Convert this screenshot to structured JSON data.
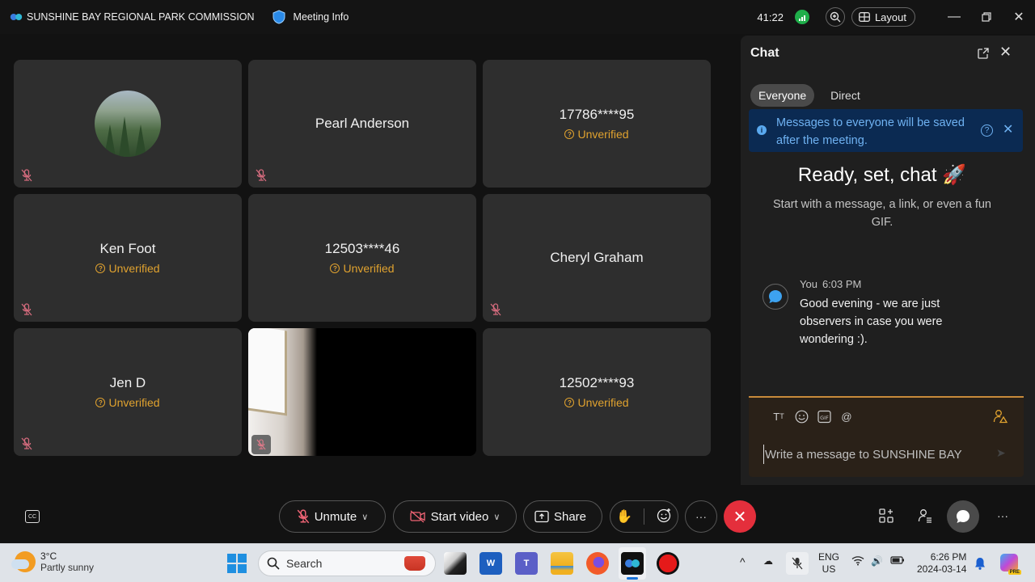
{
  "titlebar": {
    "app_title": "SUNSHINE BAY REGIONAL PARK COMMISSION",
    "meeting_info": "Meeting Info",
    "timer": "41:22",
    "layout_label": "Layout"
  },
  "participants": [
    {
      "name": "",
      "avatar": "forest-photo",
      "muted": true
    },
    {
      "name": "Pearl Anderson",
      "status": "",
      "muted": true
    },
    {
      "name": "17786****95",
      "status": "Unverified",
      "muted": false
    },
    {
      "name": "Ken Foot",
      "status": "Unverified",
      "muted": true
    },
    {
      "name": "12503****46",
      "status": "Unverified",
      "muted": false
    },
    {
      "name": "Cheryl Graham",
      "status": "",
      "muted": true
    },
    {
      "name": "Jen D",
      "status": "Unverified",
      "muted": true
    },
    {
      "name": "",
      "video": "live",
      "muted": true
    },
    {
      "name": "12502****93",
      "status": "Unverified",
      "muted": false
    }
  ],
  "chat": {
    "title": "Chat",
    "tabs": [
      "Everyone",
      "Direct"
    ],
    "active_tab": "Everyone",
    "notice": "Messages to everyone will be saved after the meeting.",
    "empty_title": "Ready, set, chat",
    "empty_emoji": "🚀",
    "empty_subtitle": "Start with a message, a link, or even a fun GIF.",
    "messages": [
      {
        "sender": "You",
        "time": "6:03 PM",
        "text": "Good evening - we are just observers in case you were wondering :)."
      }
    ],
    "composer": {
      "placeholder": "Write a message to SUNSHINE BAY",
      "value": "",
      "tools": [
        "text-format-icon",
        "emoji-icon",
        "gif-icon",
        "mention-icon"
      ]
    }
  },
  "controls": {
    "unmute": "Unmute",
    "start_video": "Start video",
    "share": "Share",
    "more": "···",
    "right_more": "···"
  },
  "taskbar": {
    "weather_temp": "3°C",
    "weather_desc": "Partly sunny",
    "search_placeholder": "Search",
    "lang_1": "ENG",
    "lang_2": "US",
    "time": "6:26 PM",
    "date": "2024-03-14",
    "copilot_badge": "PRE"
  },
  "colors": {
    "accent_unverified": "#e0a22f",
    "leave_red": "#e42f3c",
    "notice_blue": "#0b2a52",
    "signal_green": "#1fae4a"
  }
}
